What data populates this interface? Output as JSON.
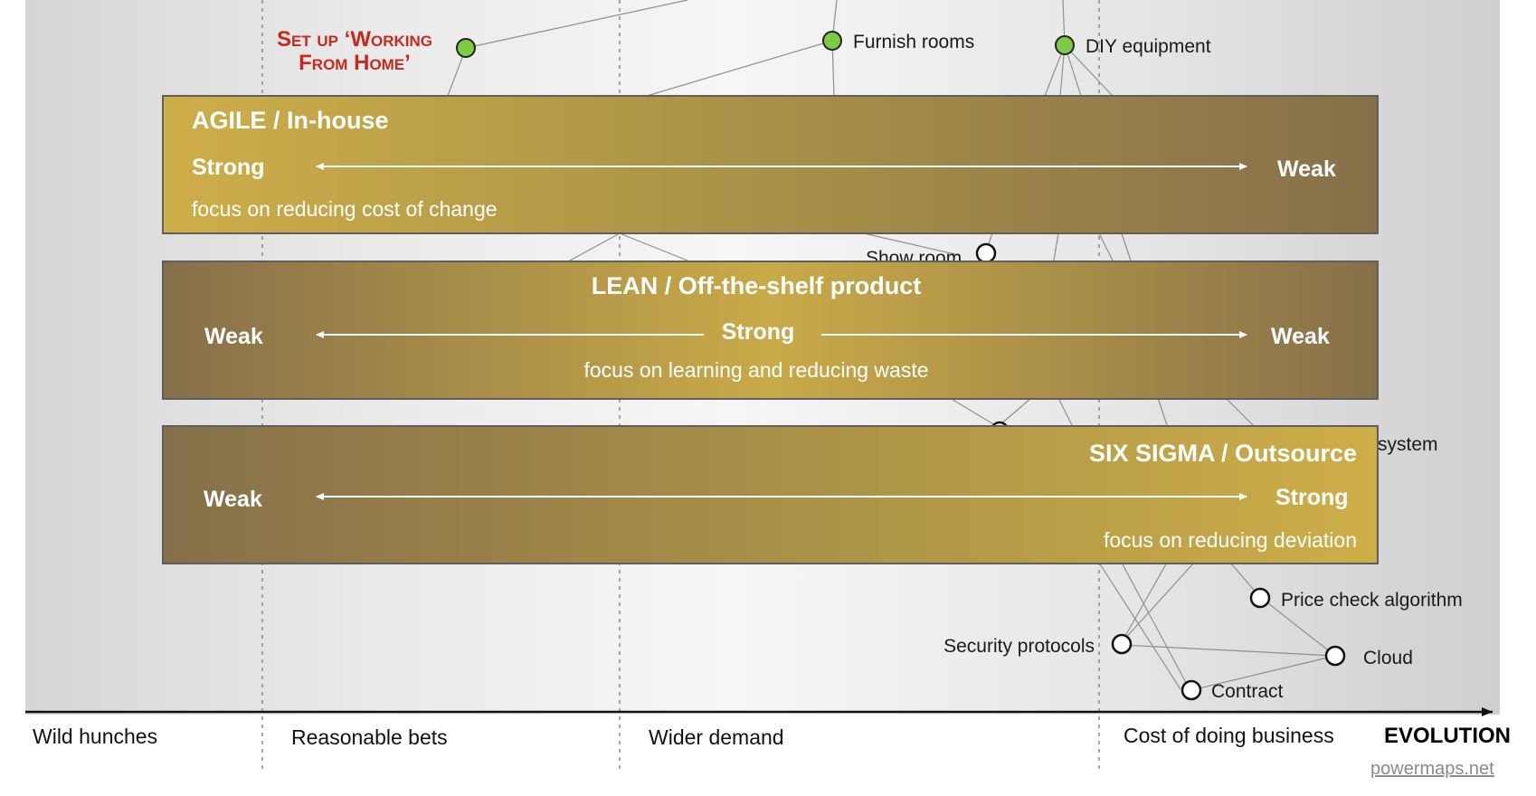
{
  "top_label": {
    "line1": "Set up ‘Working",
    "line2": "From Home’"
  },
  "components": {
    "furnish_rooms": "Furnish rooms",
    "diy_equipment": "DIY equipment",
    "show_room": "Show room",
    "system": "system",
    "price_check": "Price check algorithm",
    "security": "Security protocols",
    "cloud": "Cloud",
    "contract": "Contract"
  },
  "bands": {
    "agile": {
      "title": "AGILE / In-house",
      "left": "Strong",
      "right": "Weak",
      "subtitle": "focus on reducing cost of change"
    },
    "lean": {
      "title": "LEAN / Off-the-shelf product",
      "left": "Weak",
      "middle": "Strong",
      "right": "Weak",
      "subtitle": "focus on learning and reducing waste"
    },
    "sixsigma": {
      "title": "SIX SIGMA / Outsource",
      "left": "Weak",
      "right": "Strong",
      "subtitle": "focus on reducing deviation"
    }
  },
  "axis": {
    "phases": [
      "Wild hunches",
      "Reasonable bets",
      "Wider demand",
      "Cost of doing business"
    ],
    "label": "EVOLUTION"
  },
  "credit": "powermaps.net",
  "colors": {
    "band_gold": "#c9aa47",
    "band_dark": "#86704a",
    "node_green": "#7ccc45",
    "title_red": "#c8281e"
  }
}
